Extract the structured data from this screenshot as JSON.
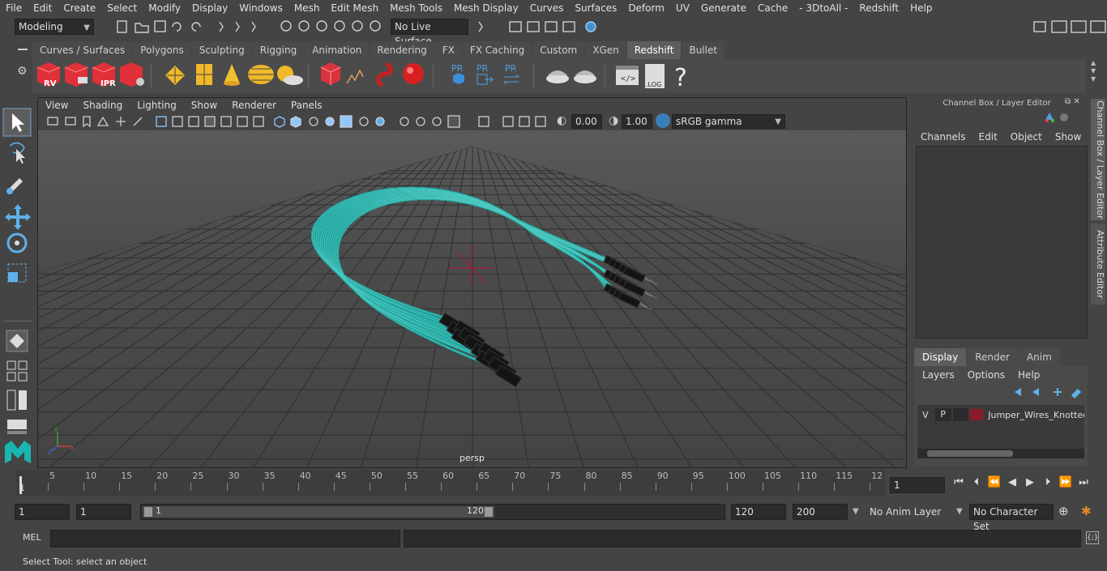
{
  "menubar": [
    "File",
    "Edit",
    "Create",
    "Select",
    "Modify",
    "Display",
    "Windows",
    "Mesh",
    "Edit Mesh",
    "Mesh Tools",
    "Mesh Display",
    "Curves",
    "Surfaces",
    "Deform",
    "UV",
    "Generate",
    "Cache",
    "- 3DtoAll -",
    "Redshift",
    "Help"
  ],
  "toolbar": {
    "mode": "Modeling",
    "live_surface": "No Live Surface"
  },
  "shelf": {
    "tabs": [
      "Curves / Surfaces",
      "Polygons",
      "Sculpting",
      "Rigging",
      "Animation",
      "Rendering",
      "FX",
      "FX Caching",
      "Custom",
      "XGen",
      "Redshift",
      "Bullet"
    ],
    "active_tab": "Redshift",
    "icons": [
      "rv-icon",
      "redshift-render-icon",
      "ipr-icon",
      "redshift-settings-icon",
      "light-diamond-icon",
      "area-light-icon",
      "spot-light-icon",
      "dome-light-icon",
      "sun-sky-icon",
      "proxy-box-icon",
      "hair-curves-icon",
      "volume-icon",
      "sphere-light-icon",
      "pr-box-icon",
      "pr-export-icon",
      "pr-swap-icon",
      "bake-icon",
      "bake-all-icon",
      "script-editor-icon",
      "log-icon",
      "help-icon"
    ],
    "labels": {
      "rv": "RV",
      "ipr": "IPR",
      "pr": "PR",
      "log": ".LOG",
      "help": "?"
    }
  },
  "viewport": {
    "menu": [
      "View",
      "Shading",
      "Lighting",
      "Show",
      "Renderer",
      "Panels"
    ],
    "exposure": "0.00",
    "gamma": "1.00",
    "color_space": "sRGB gamma",
    "camera_label": "persp"
  },
  "channel_box": {
    "title": "Channel Box / Layer Editor",
    "menu": [
      "Channels",
      "Edit",
      "Object",
      "Show"
    ],
    "side_tabs": [
      "Channel Box / Layer Editor",
      "Attribute Editor"
    ]
  },
  "layer_editor": {
    "tabs": [
      "Display",
      "Render",
      "Anim"
    ],
    "active_tab": "Display",
    "menu": [
      "Layers",
      "Options",
      "Help"
    ],
    "layers": [
      {
        "v": "V",
        "p": "P",
        "color": "#8b1a2b",
        "name": "Jumper_Wires_Knotted"
      }
    ]
  },
  "timeline": {
    "ticks": [
      "5",
      "10",
      "15",
      "20",
      "25",
      "30",
      "35",
      "40",
      "45",
      "50",
      "55",
      "60",
      "65",
      "70",
      "75",
      "80",
      "85",
      "90",
      "95",
      "100",
      "105",
      "110",
      "115",
      "12"
    ],
    "start_marker": "1",
    "current_frame": "1"
  },
  "range": {
    "start": "1",
    "playback_start": "1",
    "slider_start": "1",
    "slider_end": "120",
    "playback_end": "120",
    "end": "200",
    "anim_layer": "No Anim Layer",
    "character_set": "No Character Set"
  },
  "command": {
    "label": "MEL"
  },
  "status": {
    "help": "Select Tool: select an object"
  },
  "colors": {
    "wire": "#1fa39c",
    "connector": "#141414",
    "accent": "#5d9ad6"
  }
}
